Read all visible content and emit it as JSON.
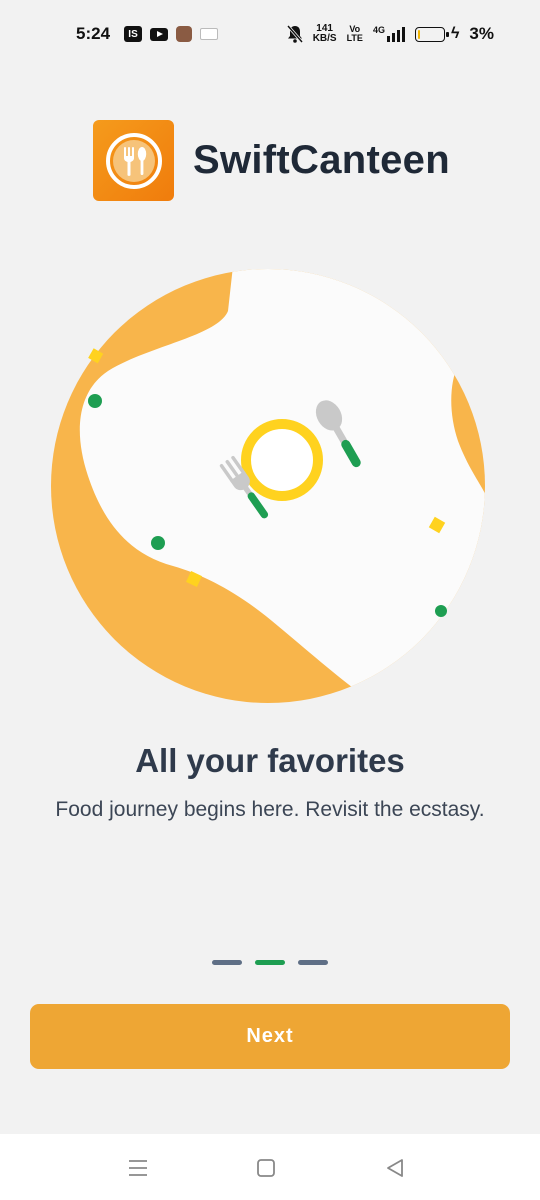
{
  "status_bar": {
    "time": "5:24",
    "app_badge": "IS",
    "network_speed": "141",
    "network_speed_unit": "KB/S",
    "volte_top": "Vo",
    "volte_bottom": "LTE",
    "network_type": "4G",
    "battery_percent": "3%",
    "battery_level": 0.03
  },
  "brand": {
    "name": "SwiftCanteen",
    "logo_icon": "fork-knife-plate-icon",
    "logo_color": "#f28a12"
  },
  "illustration": {
    "icon": "plate-with-fork-and-spoon-icon",
    "accent_color": "#f8b54b",
    "plate_color": "#ffd21f",
    "handle_color": "#1e9e52"
  },
  "onboarding": {
    "title": "All your favorites",
    "subtitle": "Food journey begins here. Revisit the ecstasy.",
    "page_count": 3,
    "active_page": 2
  },
  "actions": {
    "next_label": "Next",
    "button_color": "#eea634"
  },
  "nav_bar": {
    "recents_icon": "menu-lines-icon",
    "home_icon": "square-home-icon",
    "back_icon": "triangle-back-icon"
  }
}
